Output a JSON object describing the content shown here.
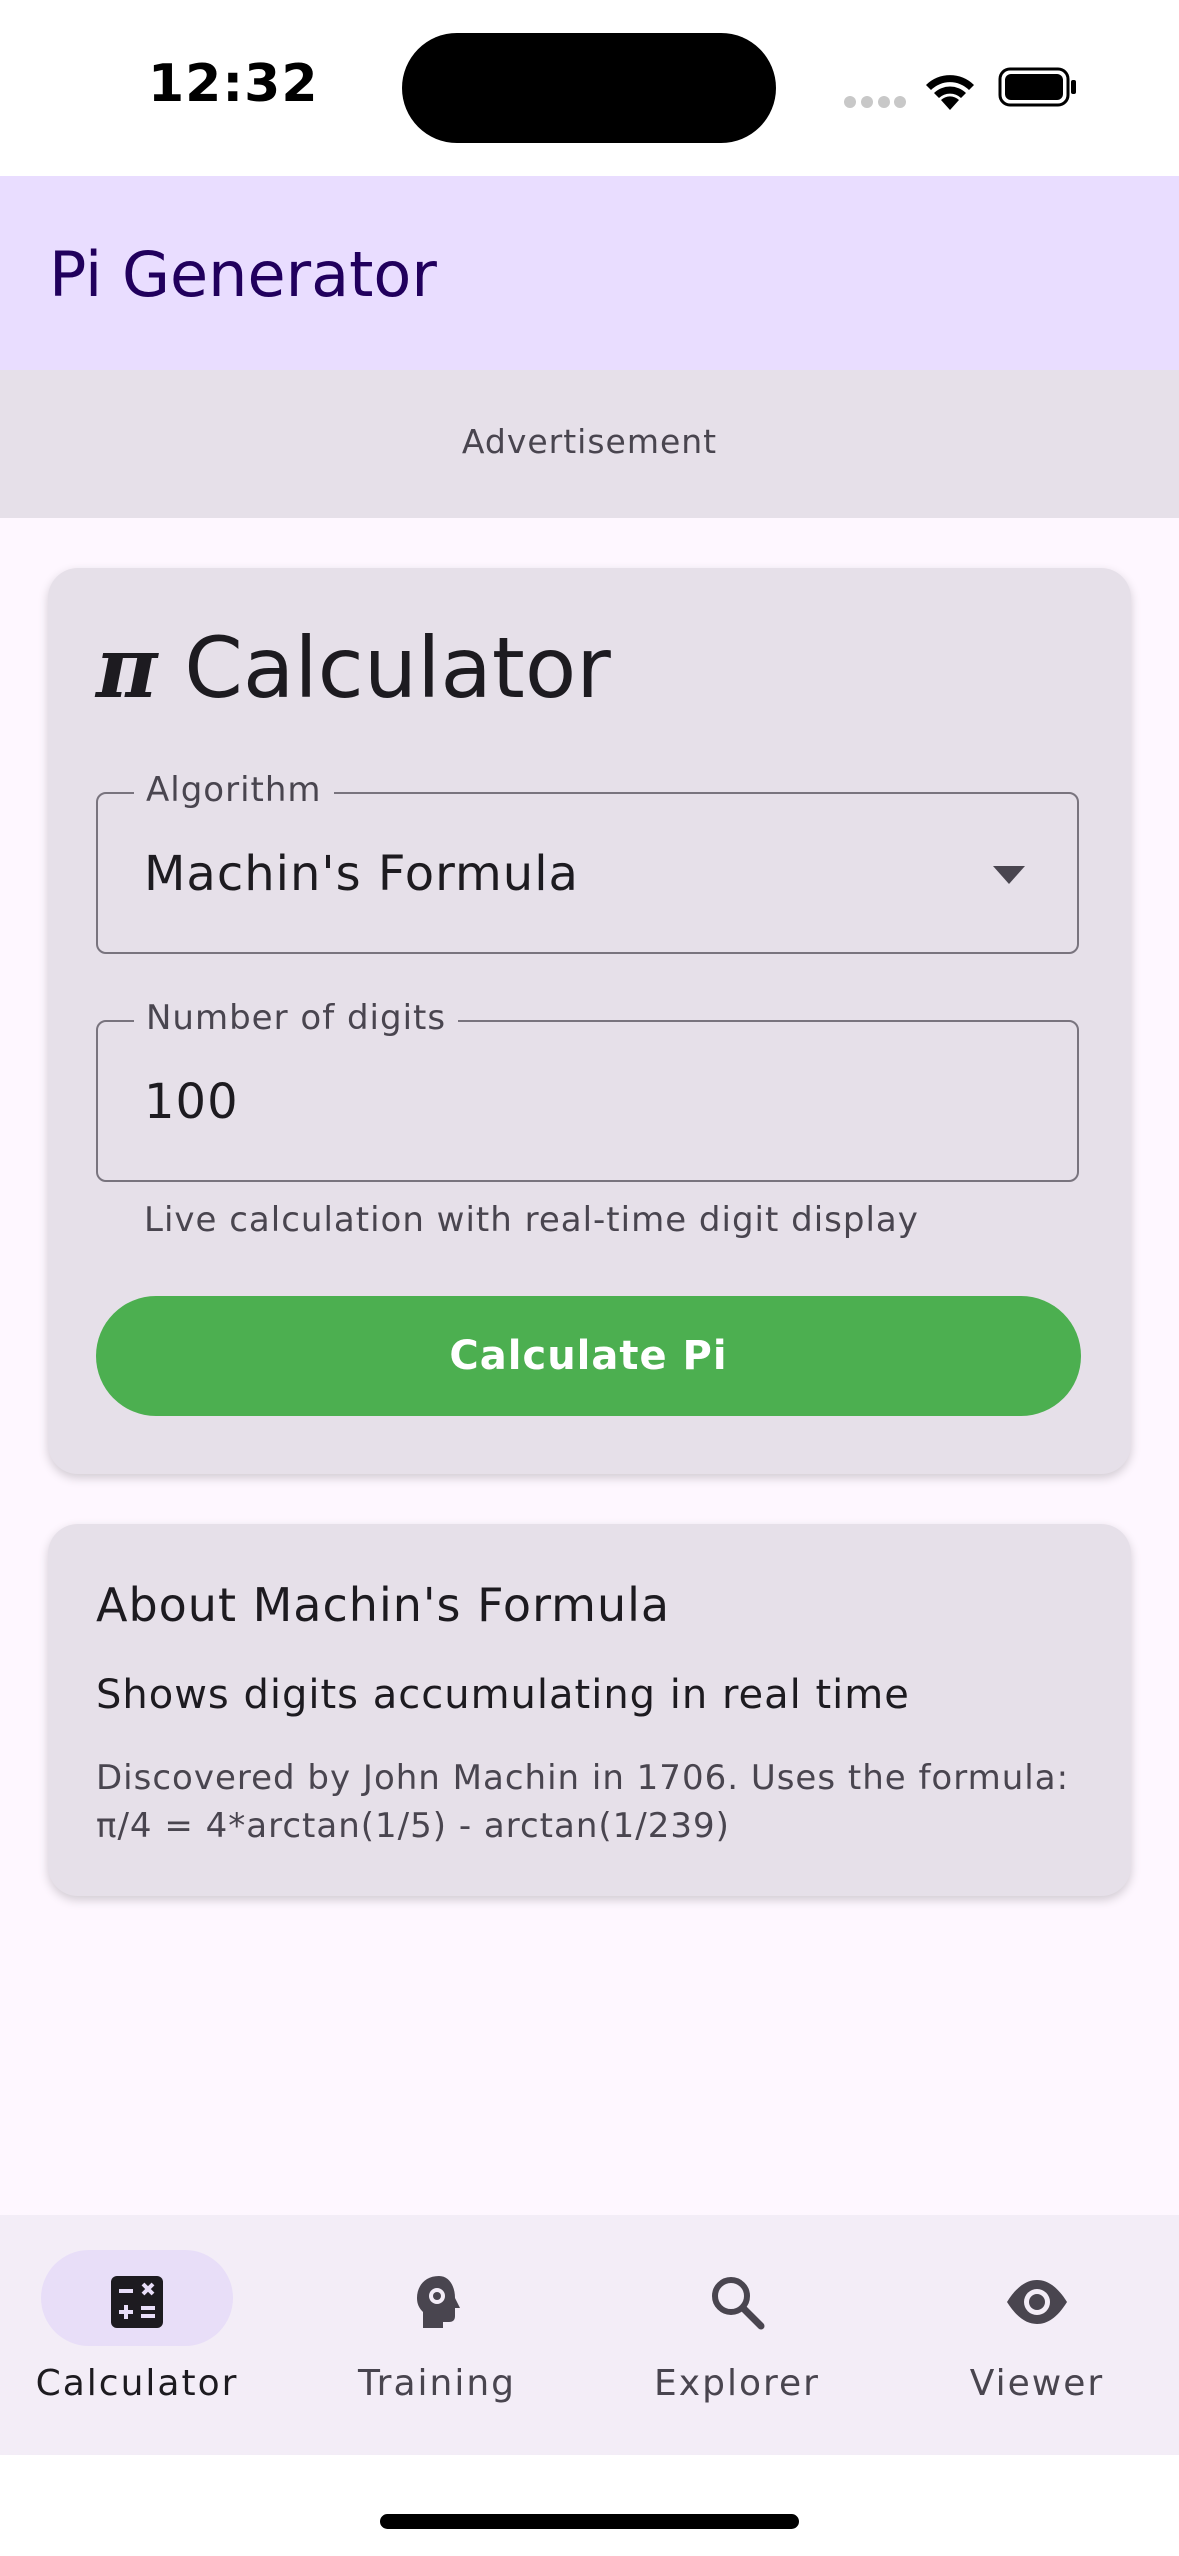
{
  "status_bar": {
    "time": "12:32",
    "icons": [
      "signal-dots-icon",
      "wifi-icon",
      "battery-icon"
    ]
  },
  "app_bar": {
    "title": "Pi Generator"
  },
  "ad_banner": {
    "label": "Advertisement"
  },
  "calculator_card": {
    "title_symbol": "π",
    "title_text": "Calculator",
    "algorithm_field": {
      "label": "Algorithm",
      "value": "Machin's Formula",
      "icon": "dropdown-arrow-icon"
    },
    "digits_field": {
      "label": "Number of digits",
      "value": "100",
      "helper": "Live calculation with real-time digit display"
    },
    "calculate_button": "Calculate Pi",
    "button_color": "#4caf50"
  },
  "about_card": {
    "title": "About Machin's Formula",
    "subtitle": "Shows digits accumulating in real time",
    "description": "Discovered by John Machin in 1706. Uses the formula: π/4 = 4*arctan(1/5) - arctan(1/239)"
  },
  "bottom_nav": {
    "items": [
      {
        "label": "Calculator",
        "icon": "calculator-icon",
        "active": true
      },
      {
        "label": "Training",
        "icon": "psychology-icon",
        "active": false
      },
      {
        "label": "Explorer",
        "icon": "search-icon",
        "active": false
      },
      {
        "label": "Viewer",
        "icon": "eye-icon",
        "active": false
      }
    ]
  },
  "colors": {
    "app_bar_bg": "#e9ddff",
    "app_title": "#21005d",
    "card_bg": "#e6e0e9",
    "page_bg": "#fef7ff",
    "nav_bg": "#f3edf7",
    "nav_active_pill": "#e8def8"
  }
}
